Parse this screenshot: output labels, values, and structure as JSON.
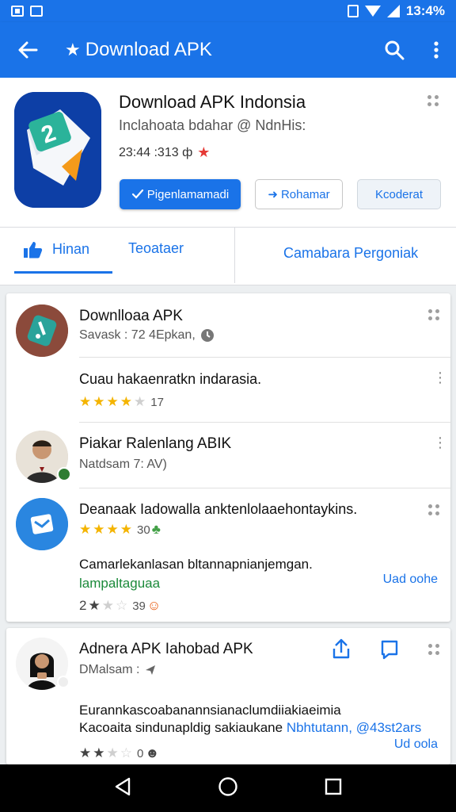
{
  "status_bar": {
    "time": "13:4%"
  },
  "app_bar": {
    "title": "Download APK",
    "icons": [
      "back-arrow-icon",
      "star-icon",
      "search-icon",
      "more-vert-icon"
    ]
  },
  "app": {
    "name": "Download APK Indonsia",
    "subtitle": "Inclahoata bdahar @ NdnHis:",
    "meta": "23:44 :313 ф",
    "install_button": "Pigenlamamadi",
    "secondary_button": "Rohamar",
    "tertiary_button": "Kcoderat"
  },
  "tabs": {
    "active": "Hinan",
    "second": "Teoataer",
    "third": "Camabara Pergoniak"
  },
  "list": [
    {
      "title": "Downlloaa APK",
      "sub": "Savask : 72 4Epkan,"
    },
    {
      "title": "Cuau hakaenratkn indarasia.",
      "rating_count": "17"
    },
    {
      "title": "Piakar Ralenlang ABIK",
      "sub": "Natdsam 7: AV)"
    },
    {
      "title": "Deanaak Iadowalla anktenlolaaehontaykins.",
      "rating_count": "30",
      "body": "Camarlekanlasan bltannapnianjemgan.",
      "green": "lampaltaguaa",
      "link": "Uad oohe",
      "rating2_count": "39",
      "rating2_label": "2"
    },
    {
      "title": "Adnera APK Iahobad APK",
      "sub": "DMalsam : ",
      "body1": "Eurannkascoabanannsianaclumdiiakiaeimia",
      "body2": "Kacoaita sindunapldig sakiaukane",
      "link_inline": "Nbhtutann,",
      "link_handle": "@43st2ars",
      "link2": "Ud oola",
      "rating_count": "0"
    }
  ],
  "colors": {
    "primary": "#1a73e8",
    "star": "#f4b400",
    "green": "#1b8a3a",
    "nav_bar": "#000000"
  }
}
